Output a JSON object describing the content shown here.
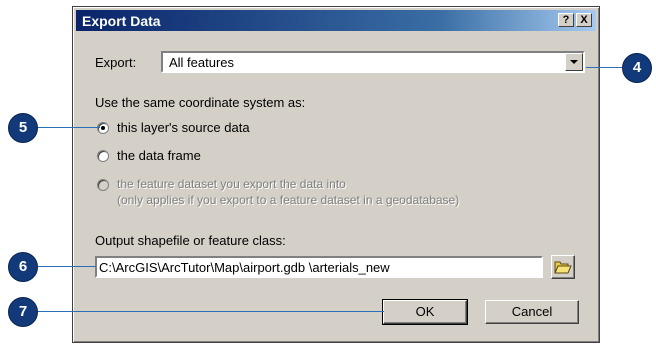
{
  "dialog": {
    "title": "Export Data",
    "help_button": "?",
    "close_button": "X"
  },
  "export": {
    "label": "Export:",
    "selected": "All features"
  },
  "coordinate": {
    "heading": "Use the same coordinate system as:",
    "options": [
      {
        "label": "this layer's source data",
        "selected": true,
        "enabled": true
      },
      {
        "label": "the data frame",
        "selected": false,
        "enabled": true
      },
      {
        "label": "the feature dataset you export the data into",
        "sublabel": "(only applies if you export to a feature dataset in a geodatabase)",
        "selected": false,
        "enabled": false
      }
    ]
  },
  "output": {
    "label": "Output shapefile or feature class:",
    "value": "C:\\ArcGIS\\ArcTutor\\Map\\airport.gdb \\arterials_new",
    "browse_icon": "open-folder-icon"
  },
  "buttons": {
    "ok": "OK",
    "cancel": "Cancel"
  },
  "callouts": [
    "4",
    "5",
    "6",
    "7"
  ],
  "colors": {
    "callout": "#123a7a",
    "leader": "#2a6fb5",
    "title_bar": "#0a246a"
  }
}
